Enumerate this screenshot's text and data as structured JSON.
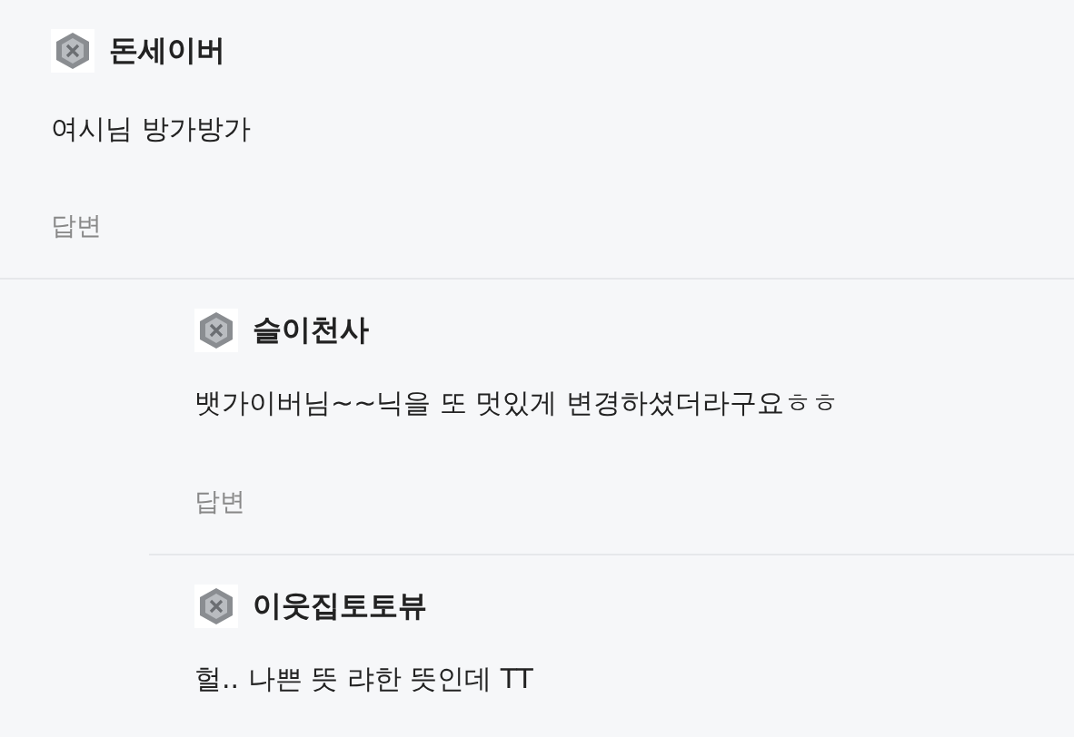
{
  "comments": [
    {
      "author": "돈세이버",
      "body": "여시님 방가방가",
      "reply_label": "답변",
      "children": [
        {
          "author": "슬이천사",
          "body": "뱃가이버님~~닉을 또 멋있게 변경하셨더라구요ㅎㅎ",
          "reply_label": "답변"
        },
        {
          "author": "이웃집토토뷰",
          "body": "헐.. 나쁜 뜻 랴한 뜻인데 TT"
        }
      ]
    }
  ]
}
